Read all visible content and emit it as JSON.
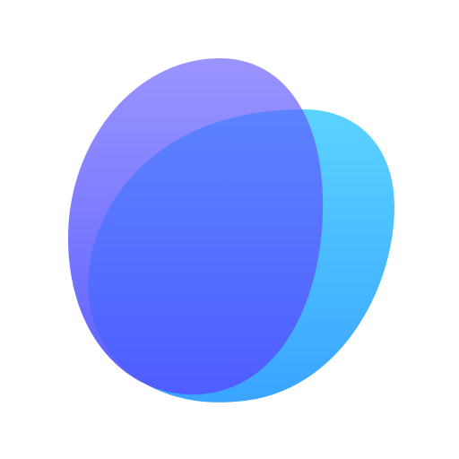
{
  "logo": {
    "icon": "overlapping-blobs-logo-icon",
    "background": "#ffffff",
    "colors": {
      "purple_top": "#9a93ff",
      "purple_bottom": "#5b63ff",
      "cyan_top": "#5fd0ff",
      "cyan_bottom": "#3aa6ff",
      "overlap_top": "#5b7cff",
      "overlap_bottom": "#4f5cff"
    }
  }
}
